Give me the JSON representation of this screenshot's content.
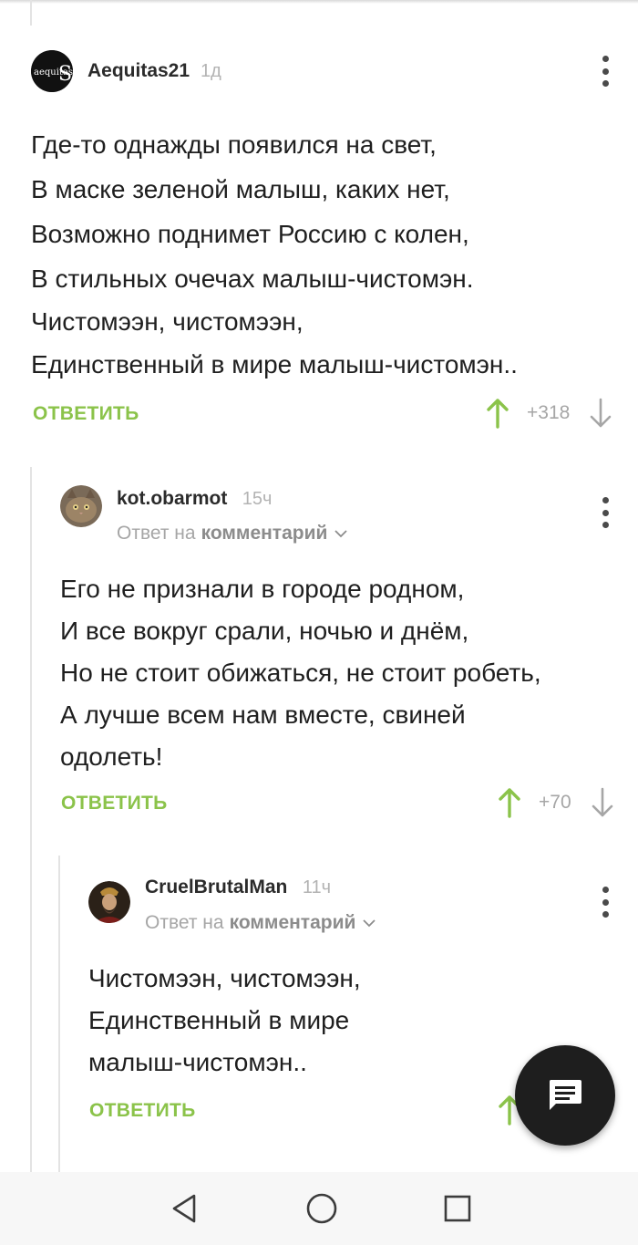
{
  "comments": [
    {
      "author": "Aequitas21",
      "time": "1д",
      "avatar_text": "aequitas",
      "lines": [
        "Где-то однажды появился на свет,",
        "В маске зеленой малыш, каких нет,",
        "Возможно поднимет Россию с колен,",
        "В стильных очечах малыш-чистомэн.",
        "Чистомээн, чистомээн,",
        "Единственный в мире малыш-чистомэн.."
      ],
      "reply_label": "ОТВЕТИТЬ",
      "score": "+318"
    },
    {
      "author": "kot.obarmot",
      "time": "15ч",
      "reply_prefix": "Ответ на",
      "reply_target": "комментарий",
      "lines": [
        "Его не признали в городе родном,",
        "И все вокруг срали, ночью и днём,",
        "Но не стоит обижаться, не стоит робеть,",
        "А лучше всем нам вместе, свиней",
        "одолеть!"
      ],
      "reply_label": "ОТВЕТИТЬ",
      "score": "+70"
    },
    {
      "author": "CruelBrutalMan",
      "time": "11ч",
      "reply_prefix": "Ответ на",
      "reply_target": "комментарий",
      "lines": [
        "Чистомээн, чистомээн,",
        "Единственный в мире",
        "малыш-чистомэн.."
      ],
      "reply_label": "ОТВЕТИТЬ"
    }
  ],
  "icons": {
    "upvote": "arrow-up-icon",
    "downvote": "arrow-down-icon",
    "more": "kebab-menu-icon",
    "chevron": "chevron-down-icon",
    "fab": "comment-icon",
    "nav_back": "back-triangle-icon",
    "nav_home": "home-circle-icon",
    "nav_recent": "recents-square-icon"
  },
  "colors": {
    "accent_green": "#8bc34a",
    "text": "#1f1f1f",
    "muted": "#a6a6a6",
    "fab": "#1e1e1e"
  }
}
